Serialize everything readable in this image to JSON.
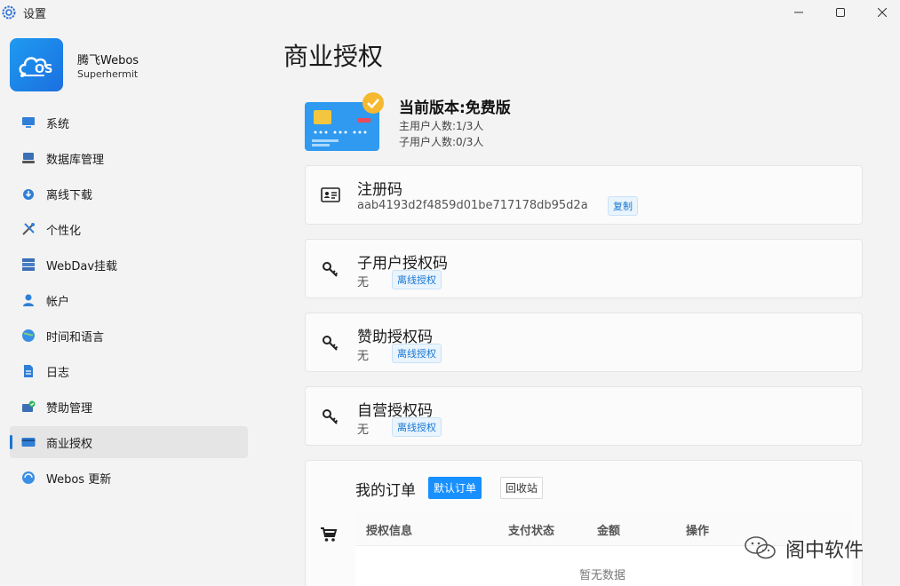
{
  "window": {
    "title": "设置"
  },
  "profile": {
    "name": "腾飞Webos",
    "subtitle": "Superhermit"
  },
  "sidebar": {
    "items": [
      {
        "label": "系统",
        "icon": "monitor-icon"
      },
      {
        "label": "数据库管理",
        "icon": "database-icon"
      },
      {
        "label": "离线下载",
        "icon": "cloud-download-icon"
      },
      {
        "label": "个性化",
        "icon": "paint-tools-icon"
      },
      {
        "label": "WebDav挂载",
        "icon": "server-stack-icon"
      },
      {
        "label": "帐户",
        "icon": "user-icon"
      },
      {
        "label": "时间和语言",
        "icon": "globe-clock-icon"
      },
      {
        "label": "日志",
        "icon": "document-icon"
      },
      {
        "label": "赞助管理",
        "icon": "sponsor-card-icon"
      },
      {
        "label": "商业授权",
        "icon": "credit-card-icon",
        "active": true
      },
      {
        "label": "Webos 更新",
        "icon": "update-globe-icon"
      }
    ]
  },
  "main": {
    "title": "商业授权",
    "license": {
      "title": "当前版本:免费版",
      "main_users": "主用户人数:1/3人",
      "sub_users": "子用户人数:0/3人"
    },
    "register": {
      "title": "注册码",
      "code": "aab4193d2f4859d01be717178db95d2a",
      "copy_label": "复制"
    },
    "sub_auth": {
      "title": "子用户授权码",
      "value": "无",
      "tag": "离线授权"
    },
    "sponsor_auth": {
      "title": "赞助授权码",
      "value": "无",
      "tag": "离线授权"
    },
    "self_auth": {
      "title": "自营授权码",
      "value": "无",
      "tag": "离线授权"
    },
    "orders": {
      "title": "我的订单",
      "default_btn": "默认订单",
      "recycle_btn": "回收站",
      "columns": [
        "授权信息",
        "支付状态",
        "金额",
        "操作"
      ],
      "empty_text": "暂无数据"
    }
  },
  "watermark": {
    "text": "阁中软件"
  },
  "colors": {
    "accent": "#1677d4",
    "primary_button": "#1890ff",
    "sidebar_active": "#e5e5e5"
  }
}
